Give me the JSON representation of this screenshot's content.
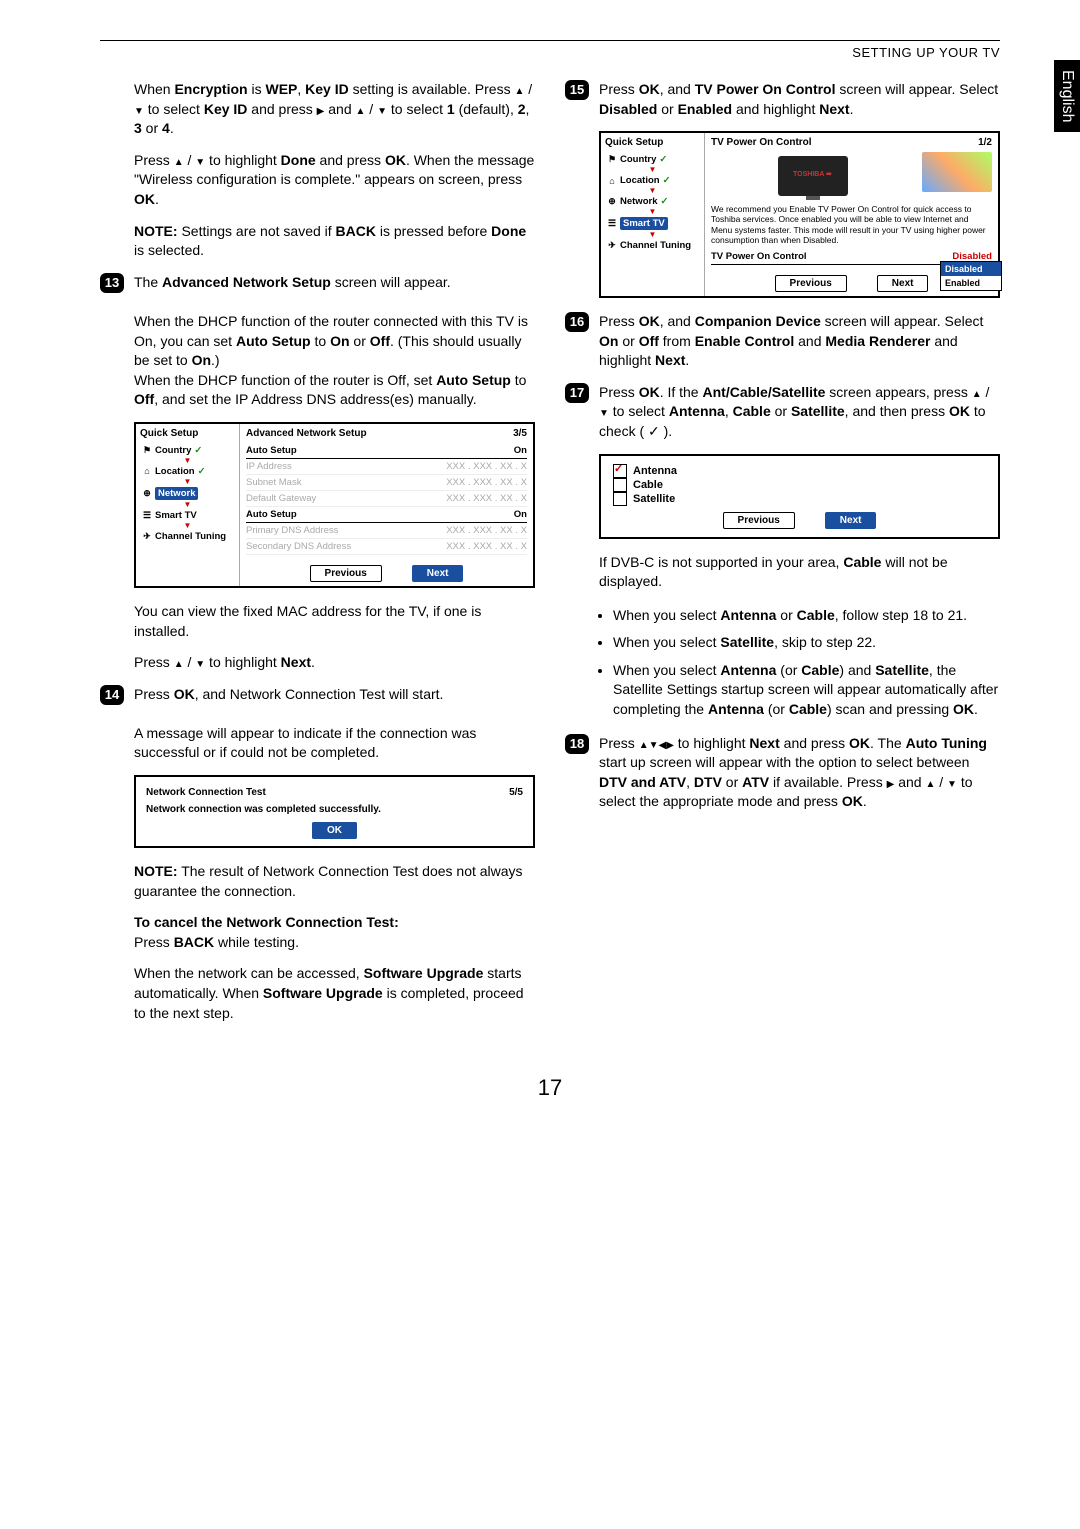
{
  "header": "SETTING UP YOUR TV",
  "language_tab": "English",
  "page_number": "17",
  "left_column": {
    "intro_p1_a": "When ",
    "intro_p1_enc": "Encryption",
    "intro_p1_b": " is ",
    "intro_p1_wep": "WEP",
    "intro_p1_c": ", ",
    "intro_p1_key": "Key ID",
    "intro_p1_d": " setting is available. Press ",
    "intro_p1_e": " to select ",
    "intro_p1_key2": "Key ID",
    "intro_p1_f": " and press ",
    "intro_p1_g": " and ",
    "intro_p1_h": " to select ",
    "intro_p1_1": "1",
    "intro_p1_i": " (default), ",
    "intro_p1_2": "2",
    "intro_p1_j": ", ",
    "intro_p1_3": "3",
    "intro_p1_k": " or ",
    "intro_p1_4": "4",
    "intro_p1_l": ".",
    "intro_p2_a": "Press ",
    "intro_p2_b": " to highlight ",
    "intro_p2_done": "Done",
    "intro_p2_c": " and press ",
    "intro_p2_ok": "OK",
    "intro_p2_d": ". When the message \"Wireless configuration is complete.\" appears on screen, press ",
    "intro_p2_ok2": "OK",
    "intro_p2_e": ".",
    "note_a": "NOTE:",
    "note_b": " Settings are not saved if ",
    "note_back": "BACK",
    "note_c": " is pressed before ",
    "note_done": "Done",
    "note_d": " is selected.",
    "step13": {
      "num": "13",
      "a": "The ",
      "adv": "Advanced Network Setup",
      "b": " screen will appear.",
      "p2_a": "When the DHCP function of the router connected with this TV is On, you can set ",
      "p2_auto": "Auto Setup",
      "p2_b": " to ",
      "p2_on": "On",
      "p2_c": " or ",
      "p2_off": "Off",
      "p2_d": ". (This should usually be set to ",
      "p2_on2": "On",
      "p2_e": ".)",
      "p3_a": "When the DHCP function of the router is Off, set ",
      "p3_auto": "Auto Setup",
      "p3_b": " to ",
      "p3_off": "Off",
      "p3_c": ", and set the IP Address DNS address(es) manually.",
      "after_a": "You can view the fixed MAC address for the TV, if one is installed.",
      "after_b_a": "Press ",
      "after_b_b": " to highlight ",
      "after_b_next": "Next",
      "after_b_c": "."
    },
    "fig13": {
      "quick_setup": "Quick Setup",
      "country": "Country",
      "location": "Location",
      "network": "Network",
      "smart_tv": "Smart TV",
      "channel_tuning": "Channel Tuning",
      "title": "Advanced Network Setup",
      "page": "3/5",
      "auto_setup": "Auto Setup",
      "on": "On",
      "ip": "IP Address",
      "mask": "Subnet Mask",
      "gw": "Default Gateway",
      "pdns": "Primary DNS Address",
      "sdns": "Secondary DNS Address",
      "xxx": "XXX . XXX .  XX  . X",
      "previous": "Previous",
      "next": "Next"
    },
    "step14": {
      "num": "14",
      "a": "Press ",
      "ok": "OK",
      "b": ", and Network Connection Test will start.",
      "p2": "A message will appear to indicate if the connection was successful or if could not be completed.",
      "note_a": "NOTE:",
      "note_b": " The result of Network Connection Test does not always guarantee the connection.",
      "cancel_head": "To cancel the Network Connection Test:",
      "cancel_b": "Press ",
      "cancel_back": "BACK",
      "cancel_c": " while testing.",
      "p5_a": "When the network can be accessed, ",
      "p5_su": "Software Upgrade",
      "p5_b": " starts automatically. When ",
      "p5_su2": "Software Upgrade",
      "p5_c": " is completed, proceed to the next step."
    },
    "fig14": {
      "title": "Network Connection Test",
      "page": "5/5",
      "msg": "Network connection was completed successfully.",
      "ok": "OK"
    }
  },
  "right_column": {
    "step15": {
      "num": "15",
      "a": "Press ",
      "ok": "OK",
      "b": ", and ",
      "tvp": "TV Power On Control",
      "c": " screen will appear. Select ",
      "dis": "Disabled",
      "d": " or ",
      "en": "Enabled",
      "e": " and highlight ",
      "next": "Next",
      "f": "."
    },
    "fig15": {
      "quick_setup": "Quick Setup",
      "country": "Country",
      "location": "Location",
      "network": "Network",
      "smart_tv": "Smart TV",
      "channel_tuning": "Channel Tuning",
      "title": "TV Power On Control",
      "page": "1/2",
      "desc": "We recommend you Enable TV Power On Control for quick access to Toshiba services. Once enabled you will be able to view Internet and Menu systems faster. This mode will result in your TV using higher power consumption than when Disabled.",
      "row_label": "TV Power On Control",
      "row_value": "Disabled",
      "previous": "Previous",
      "next": "Next",
      "popout_disabled": "Disabled",
      "popout_enabled": "Enabled"
    },
    "step16": {
      "num": "16",
      "a": "Press ",
      "ok": "OK",
      "b": ", and ",
      "cd": "Companion Device",
      "c": " screen will appear. Select ",
      "on": "On",
      "d": " or ",
      "off": "Off",
      "e": " from ",
      "ec": "Enable Control",
      "f": " and ",
      "mr": "Media Renderer",
      "g": " and highlight ",
      "next": "Next",
      "h": "."
    },
    "step17": {
      "num": "17",
      "a": "Press ",
      "ok": "OK",
      "b": ". If the ",
      "acs": "Ant/Cable/Satellite",
      "c": " screen appears, press ",
      "d": " to select ",
      "ant": "Antenna",
      "e": ", ",
      "cab": "Cable",
      "f": " or ",
      "sat": "Satellite",
      "g": ", and then press ",
      "ok2": "OK",
      "h": " to check ( ✓ ).",
      "after_a_a": "If DVB-C is not supported in your area, ",
      "after_a_cab": "Cable",
      "after_a_b": " will not be displayed.",
      "b1_a": "When you select ",
      "b1_ant": "Antenna",
      "b1_b": " or ",
      "b1_cab": "Cable",
      "b1_c": ", follow step 18 to 21.",
      "b2_a": "When you select ",
      "b2_sat": "Satellite",
      "b2_b": ", skip to step 22.",
      "b3_a": "When you select ",
      "b3_ant": "Antenna",
      "b3_b": " (or ",
      "b3_cab": "Cable",
      "b3_c": ") and ",
      "b3_sat": "Satellite",
      "b3_d": ", the Satellite Settings startup screen will appear automatically after completing the ",
      "b3_ant2": "Antenna",
      "b3_e": " (or ",
      "b3_cab2": "Cable",
      "b3_f": ") scan and pressing ",
      "b3_ok": "OK",
      "b3_g": "."
    },
    "fig17": {
      "antenna": "Antenna",
      "cable": "Cable",
      "satellite": "Satellite",
      "previous": "Previous",
      "next": "Next"
    },
    "step18": {
      "num": "18",
      "a": "Press ",
      "b": " to highlight ",
      "next": "Next",
      "c": " and press ",
      "ok": "OK",
      "d": ". The ",
      "at": "Auto Tuning",
      "e": " start up screen will appear with the option to select between ",
      "da": "DTV and ATV",
      "f": ", ",
      "dtv": "DTV",
      "g": " or ",
      "atv": "ATV",
      "h": " if available. Press ",
      "i": " and ",
      "j": " to select the appropriate mode and press ",
      "ok2": "OK",
      "k": "."
    }
  }
}
